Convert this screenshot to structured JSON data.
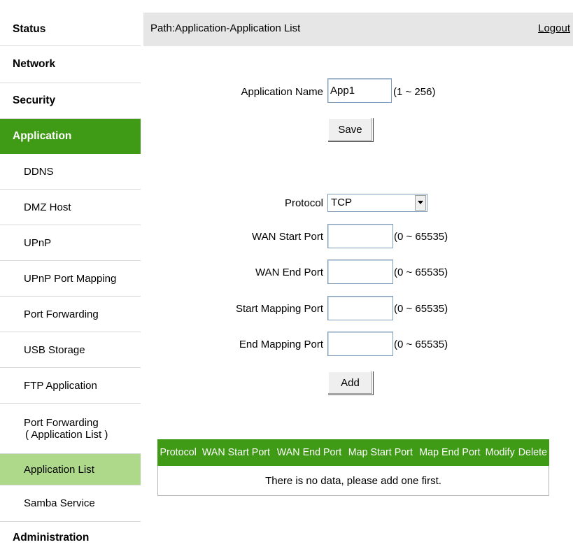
{
  "sidebar": {
    "items": [
      {
        "label": "Status"
      },
      {
        "label": "Network"
      },
      {
        "label": "Security"
      },
      {
        "label": "Application"
      },
      {
        "label": "DDNS"
      },
      {
        "label": "DMZ Host"
      },
      {
        "label": "UPnP"
      },
      {
        "label": "UPnP Port Mapping"
      },
      {
        "label": "Port Forwarding"
      },
      {
        "label": "USB Storage"
      },
      {
        "label": "FTP Application"
      },
      {
        "label": "Port Forwarding",
        "label2": "( Application List )"
      },
      {
        "label": "Application List"
      },
      {
        "label": "Samba Service"
      },
      {
        "label": "Administration"
      }
    ]
  },
  "header": {
    "path": "Path:Application-Application List",
    "logout": "Logout"
  },
  "form": {
    "app_name_label": "Application Name",
    "app_name_value": "App1",
    "app_name_hint": "(1 ~ 256)",
    "save_label": "Save",
    "protocol_label": "Protocol",
    "protocol_value": "TCP",
    "wan_start_label": "WAN Start Port",
    "wan_start_value": "",
    "wan_start_hint": "(0 ~ 65535)",
    "wan_end_label": "WAN End Port",
    "wan_end_value": "",
    "wan_end_hint": "(0 ~ 65535)",
    "start_map_label": "Start Mapping Port",
    "start_map_value": "",
    "start_map_hint": "(0 ~ 65535)",
    "end_map_label": "End Mapping Port",
    "end_map_value": "",
    "end_map_hint": "(0 ~ 65535)",
    "add_label": "Add"
  },
  "table": {
    "headers": [
      "Protocol",
      "WAN Start Port",
      "WAN End Port",
      "Map Start Port",
      "Map End Port",
      "Modify",
      "Delete"
    ],
    "empty_message": "There is no data, please add one first."
  },
  "icons": {
    "dropdown": "chevron-down-icon"
  },
  "colors": {
    "accent": "#3f9a16",
    "active_sub": "#aed98a",
    "header_bg": "#e6e6e6"
  }
}
